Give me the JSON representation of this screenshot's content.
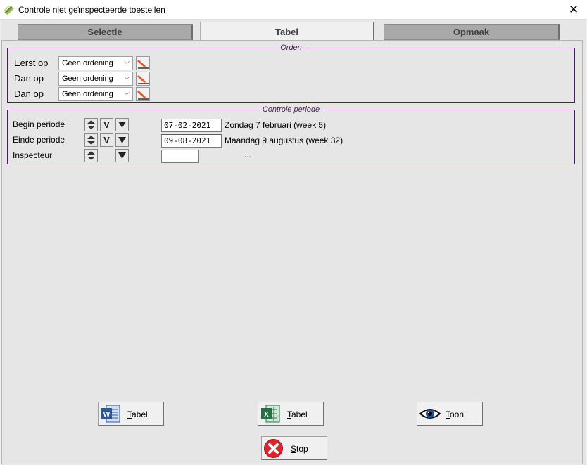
{
  "window": {
    "title": "Controle niet geïnspecteerde toestellen",
    "close": "✕"
  },
  "tabs": [
    {
      "label": "Selectie",
      "active": false
    },
    {
      "label": "Tabel",
      "active": true
    },
    {
      "label": "Opmaak",
      "active": false
    }
  ],
  "orden": {
    "legend": "Orden",
    "rows": [
      {
        "label": "Eerst op",
        "value": "Geen ordening"
      },
      {
        "label": "Dan op",
        "value": "Geen ordening"
      },
      {
        "label": "Dan op",
        "value": "Geen ordening"
      }
    ]
  },
  "periode": {
    "legend": "Controle periode",
    "begin": {
      "label": "Begin periode",
      "v_label": "V",
      "date": "07-02-2021",
      "desc": "Zondag  7 februari (week 5)"
    },
    "einde": {
      "label": "Einde periode",
      "v_label": "V",
      "date": "09-08-2021",
      "desc": "Maandag  9 augustus (week 32)"
    },
    "inspecteur": {
      "label": "Inspecteur",
      "value": "",
      "desc": "..."
    }
  },
  "buttons": {
    "word": {
      "first": "T",
      "rest": "abel"
    },
    "excel": {
      "first": "T",
      "rest": "abel"
    },
    "toon": {
      "first": "T",
      "rest": "oon"
    },
    "stop": {
      "first": "S",
      "rest": "top"
    }
  },
  "colors": {
    "group_border": "#4b1d5c",
    "tab_inactive": "#a9a9a9",
    "word_blue": "#2b579a",
    "excel_green": "#217346",
    "stop_red": "#e0242c"
  }
}
